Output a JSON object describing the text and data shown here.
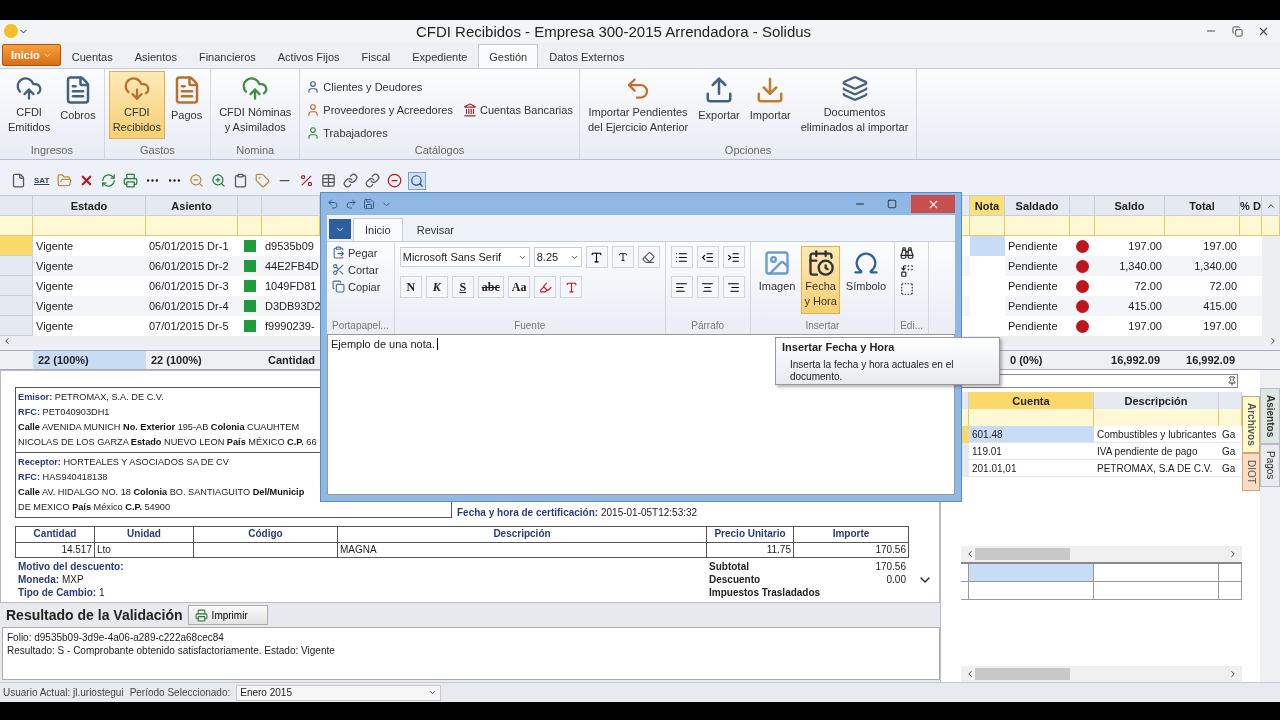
{
  "window": {
    "title": "CFDI Recibidos - Empresa 300-2015 Arrendadora - Solidus"
  },
  "ribbon": {
    "tabs": [
      {
        "label": "Inicio",
        "kind": "app",
        "selected": false
      },
      {
        "label": "Cuentas",
        "kind": "tab",
        "selected": false
      },
      {
        "label": "Asientos",
        "kind": "tab",
        "selected": false
      },
      {
        "label": "Financieros",
        "kind": "tab",
        "selected": false
      },
      {
        "label": "Activos Fijos",
        "kind": "tab",
        "selected": false
      },
      {
        "label": "Fiscal",
        "kind": "tab",
        "selected": false
      },
      {
        "label": "Expediente",
        "kind": "tab",
        "selected": false
      },
      {
        "label": "Gestión",
        "kind": "tab",
        "selected": true
      },
      {
        "label": "Datos Externos",
        "kind": "tab",
        "selected": false
      }
    ],
    "groups": [
      {
        "label": "Ingresos",
        "items": [
          {
            "kind": "large",
            "label": "CFDI\nEmitidos",
            "selected": false
          },
          {
            "kind": "large",
            "label": "Cobros",
            "selected": false
          }
        ]
      },
      {
        "label": "Gastos",
        "items": [
          {
            "kind": "large",
            "label": "CFDI\nRecibidos",
            "selected": true
          },
          {
            "kind": "large",
            "label": "Pagos",
            "selected": false
          }
        ]
      },
      {
        "label": "Nomina",
        "items": [
          {
            "kind": "large",
            "label": "CFDI Nóminas\ny Asimilados",
            "selected": false
          }
        ]
      },
      {
        "label": "Catálogos",
        "items": [
          {
            "kind": "small",
            "label": "Clientes y Deudores",
            "selected": false
          },
          {
            "kind": "small",
            "label": "Proveedores y Acreedores",
            "selected": false
          },
          {
            "kind": "small",
            "label": "Trabajadores",
            "selected": false
          },
          {
            "kind": "small",
            "label": "Cuentas Bancarias",
            "selected": false
          }
        ]
      },
      {
        "label": "Opciones",
        "items": [
          {
            "kind": "large",
            "label": "Importar Pendientes\ndel Ejercicio Anterior",
            "selected": false
          },
          {
            "kind": "large",
            "label": "Exportar",
            "selected": false
          },
          {
            "kind": "large",
            "label": "Importar",
            "selected": false
          },
          {
            "kind": "large",
            "label": "Documentos\neliminados al importar",
            "selected": false
          }
        ]
      }
    ]
  },
  "toolbar": {
    "sat_label": "SAT"
  },
  "grid": {
    "left_columns": [
      "Estado",
      "Asiento"
    ],
    "right_columns": [
      "Nota",
      "Saldado",
      "Saldo",
      "Total",
      "% D"
    ],
    "rows": [
      {
        "estado": "Vigente",
        "asiento": "05/01/2015 Dr-1",
        "status": {
          "color": "#1f9a3f"
        },
        "folio": "d9535b09",
        "saldado": "Pendiente",
        "saldado_dot": {
          "color": "#c0141c"
        },
        "saldo": "197.00",
        "total": "197.00",
        "selected": true
      },
      {
        "estado": "Vigente",
        "asiento": "06/01/2015 Dr-2",
        "status": {
          "color": "#1f9a3f"
        },
        "folio": "44E2FB4D",
        "saldado": "Pendiente",
        "saldado_dot": {
          "color": "#c0141c"
        },
        "saldo": "1,340.00",
        "total": "1,340.00",
        "selected": false
      },
      {
        "estado": "Vigente",
        "asiento": "06/01/2015 Dr-3",
        "status": {
          "color": "#1f9a3f"
        },
        "folio": "1049FD81",
        "saldado": "Pendiente",
        "saldado_dot": {
          "color": "#c0141c"
        },
        "saldo": "72.00",
        "total": "72.00",
        "selected": false
      },
      {
        "estado": "Vigente",
        "asiento": "06/01/2015 Dr-4",
        "status": {
          "color": "#1f9a3f"
        },
        "folio": "D3DB93D2",
        "saldado": "Pendiente",
        "saldado_dot": {
          "color": "#c0141c"
        },
        "saldo": "415.00",
        "total": "415.00",
        "selected": false
      },
      {
        "estado": "Vigente",
        "asiento": "07/01/2015 Dr-5",
        "status": {
          "color": "#1f9a3f"
        },
        "folio": "f9990239-",
        "saldado": "Pendiente",
        "saldado_dot": {
          "color": "#c0141c"
        },
        "saldo": "197.00",
        "total": "197.00",
        "selected": false
      }
    ],
    "summary": {
      "estado": "22 (100%)",
      "asiento": "22 (100%)",
      "column_4": "Cantidad",
      "saldado": "0 (0%)",
      "saldo": "16,992.09",
      "total": "16,992.09"
    }
  },
  "detail": {
    "emisor": [
      "**Emisor:** PETROMAX, S.A. DE C.V.",
      "**RFC:** PET040903DH1",
      "**Calle** AVENIDA MUNICH **No. Exterior** 195-AB **Colonia** CUAUHTEM",
      "NICOLAS DE LOS GARZA **Estado** NUEVO LEON **País** MÉXICO **C.P.** 66"
    ],
    "receptor": [
      "**Receptor:** HORTEALES Y ASOCIADOS SA DE CV",
      "**RFC:** HAS940418138",
      "**Calle** AV. HIDALGO NO. 18 **Colonia** BO. SANTIAGUITO **Del/Municip**",
      "DE MEXICO **País** México **C.P.** 54900"
    ],
    "certificacion": {
      "label": "Fecha y hora de certificación:",
      "value": "2015-01-05T12:53:32"
    },
    "items": {
      "columns": [
        "Cantidad",
        "Unidad",
        "Código",
        "Descripción",
        "Precio Unitario",
        "Importe"
      ],
      "rows": [
        {
          "cantidad": "14.517",
          "unidad": "Lto",
          "descripcion": "MAGNA",
          "precio": "11.75",
          "importe": "170.56"
        }
      ]
    },
    "fields": [
      {
        "label": "Motivo del descuento:"
      },
      {
        "label": "Moneda:",
        "value": "MXP"
      },
      {
        "label": "Tipo de Cambio:",
        "value": "1"
      }
    ],
    "totals": [
      {
        "label": "Subtotal",
        "value": "170.56"
      },
      {
        "label": "Descuento",
        "value": "0.00"
      },
      {
        "label": "Impuestos Trasladados"
      }
    ]
  },
  "validation": {
    "title": "Resultado de la Validación",
    "button": "Imprimir",
    "lines": [
      "Folio: d9535b09-3d9e-4a06-a289-c222a68cec84",
      "Resultado: S - Comprobante obtenido satisfactoriamente. Estado: Vigente"
    ]
  },
  "accounts": {
    "columns": [
      "Cuenta",
      "Descripción"
    ],
    "rows": [
      {
        "cuenta": "601.48",
        "descripcion": "Combustibles y lubricantes",
        "column_3": "Ga",
        "selected": true
      },
      {
        "cuenta": "119.01",
        "descripcion": "IVA pendiente de pago",
        "column_3": "Ga",
        "selected": false
      },
      {
        "cuenta": "201.01,01",
        "descripcion": "PETROMAX, S.A DE C.V.",
        "column_3": "Ga",
        "selected": false
      }
    ],
    "inner_tabs": [
      {
        "label": "Archivos",
        "selected": true
      },
      {
        "label": "DIOT",
        "selected": false
      }
    ],
    "outer_tabs": [
      {
        "label": "Asientos",
        "selected": true
      },
      {
        "label": "Pagos",
        "selected": false
      }
    ]
  },
  "status_bar": {
    "user": "Usuario Actual: jl.uriostegui",
    "period_label": "Período Seleccionado:",
    "period": "Enero 2015"
  },
  "dialog": {
    "tabs": [
      {
        "label": "Inicio",
        "selected": true
      },
      {
        "label": "Revisar",
        "selected": false
      }
    ],
    "clipboard": {
      "label": "Portapapel...",
      "items": [
        "Pegar",
        "Cortar",
        "Copiar"
      ]
    },
    "font": {
      "label": "Fuente",
      "family": "Microsoft Sans Serif",
      "size": "8.25",
      "format_buttons": [
        "N",
        "K",
        "S",
        "abc",
        "Aa"
      ]
    },
    "paragraph": {
      "label": "Párrafo"
    },
    "insert": {
      "label": "Insertar",
      "items": [
        {
          "label": "Imagen",
          "selected": false
        },
        {
          "label": "Fecha\ny Hora",
          "selected": true
        },
        {
          "label": "Símbolo",
          "selected": false
        }
      ]
    },
    "edit": {
      "label": "Edi..."
    },
    "text": "Ejemplo de una nota.",
    "tooltip": {
      "title": "Insertar Fecha y Hora",
      "body": "Inserta la fecha y hora actuales en el documento."
    }
  }
}
